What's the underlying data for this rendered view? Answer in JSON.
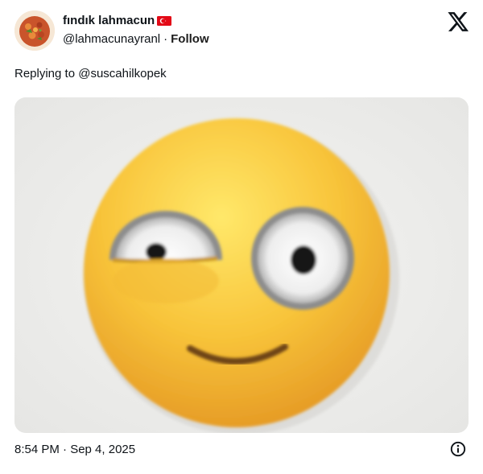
{
  "author": {
    "display_name": "fındık lahmacun",
    "flag_icon": "turkey-flag-icon",
    "handle": "@lahmacunayranl",
    "separator": "·",
    "follow_label": "Follow"
  },
  "reply": {
    "prefix": "Replying to ",
    "mention": "@suscahilkopek"
  },
  "media": {
    "icon": "smirking-emoji-image"
  },
  "footer": {
    "timestamp": "8:54 PM · Sep 4, 2025",
    "info_icon": "info-icon"
  },
  "colors": {
    "text": "#0f1419",
    "flag_red": "#e30a17",
    "emoji_yellow": "#f7c33a"
  }
}
